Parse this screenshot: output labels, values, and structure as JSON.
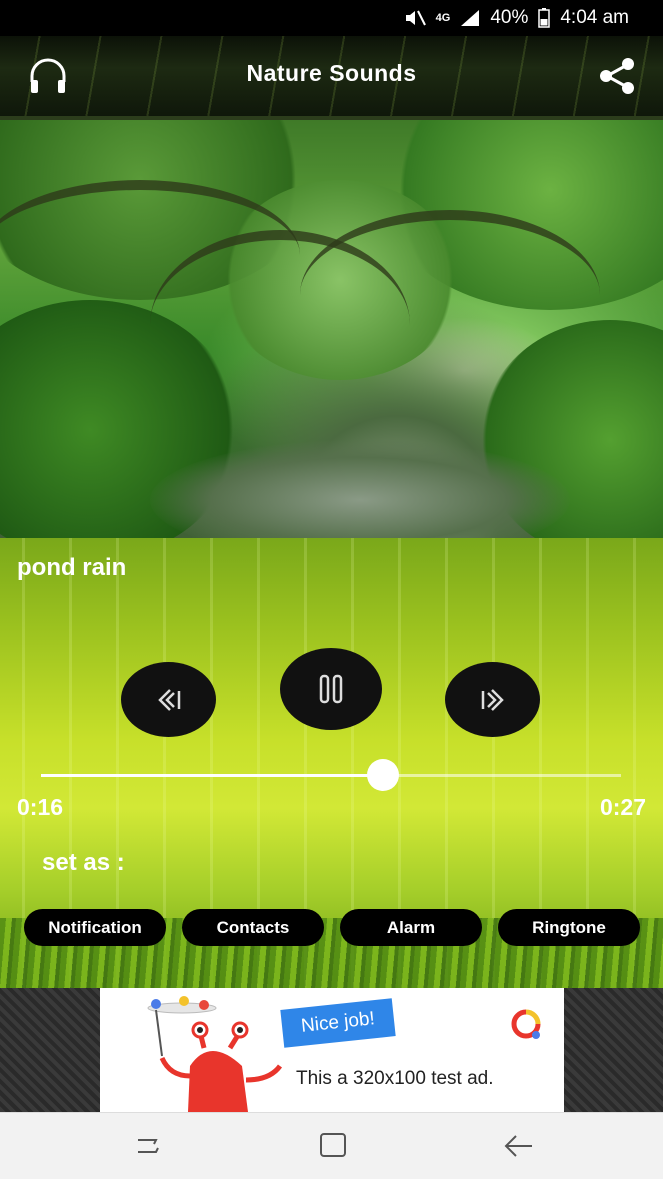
{
  "status_bar": {
    "network": "4G",
    "battery": "40%",
    "time": "4:04 am"
  },
  "app_bar": {
    "title": "Nature Sounds",
    "left_icon": "headphones-icon",
    "right_icon": "share-icon"
  },
  "player": {
    "track_title": "pond rain",
    "current_time": "0:16",
    "total_time": "0:27",
    "progress": 0.59,
    "controls": [
      "previous-icon",
      "pause-icon",
      "next-icon"
    ]
  },
  "set_as": {
    "label": "set as :",
    "options": [
      "Notification",
      "Contacts",
      "Alarm",
      "Ringtone"
    ]
  },
  "ad": {
    "banner_text": "Nice job!",
    "body_text": "This a 320x100 test ad."
  },
  "colors": {
    "chip_bg": "#000000",
    "control_bg": "#111111",
    "player_green": "#c7e02a"
  }
}
